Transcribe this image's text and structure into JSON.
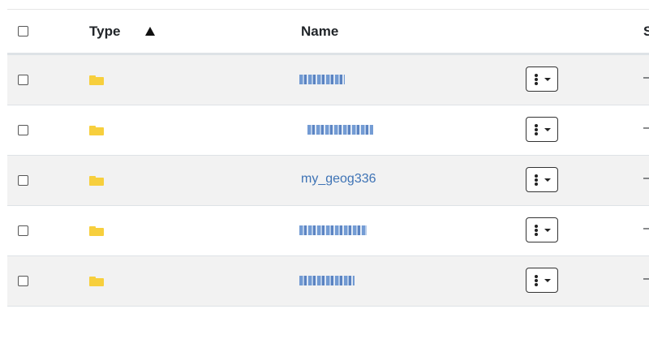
{
  "header": {
    "type_label": "Type",
    "name_label": "Name",
    "size_label": "S"
  },
  "rows": [
    {
      "icon": "folder-icon",
      "name": "",
      "size": "–"
    },
    {
      "icon": "folder-icon",
      "name": "",
      "size": "–"
    },
    {
      "icon": "folder-icon",
      "name": "my_geog336",
      "size": "–"
    },
    {
      "icon": "folder-icon",
      "name": "",
      "size": "–"
    },
    {
      "icon": "folder-icon",
      "name": "",
      "size": "–"
    }
  ],
  "colors": {
    "link": "#3e73b5",
    "folder": "#f7cf3d",
    "stripe": "#f2f2f2"
  }
}
